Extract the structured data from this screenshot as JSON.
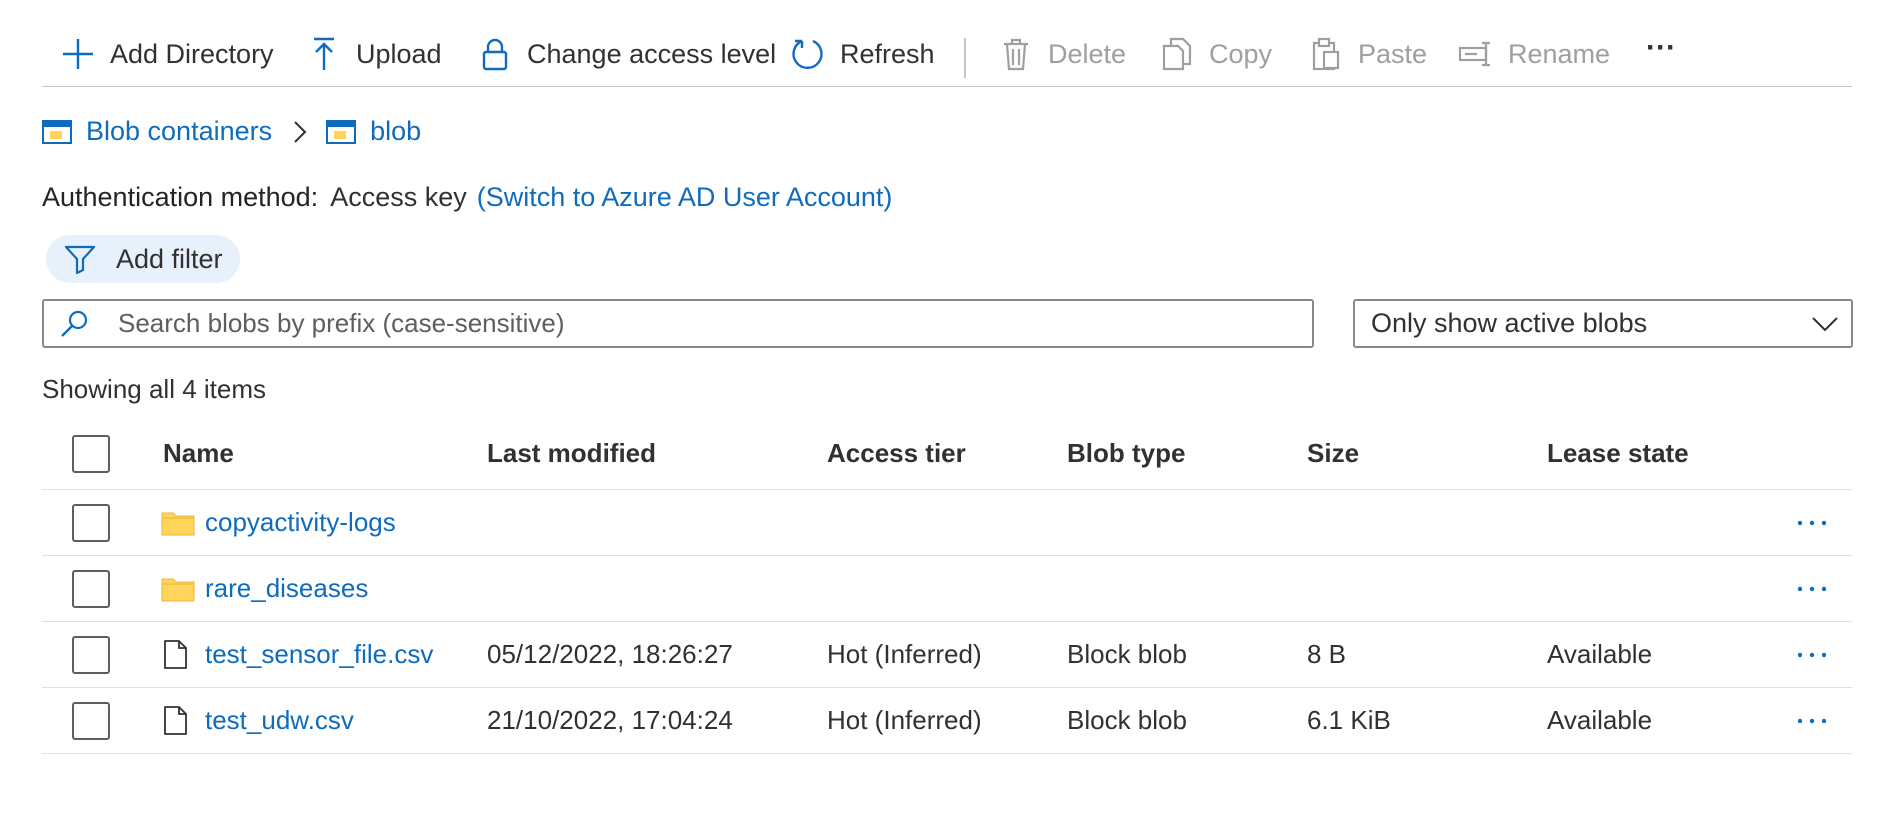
{
  "toolbar": {
    "add_directory": "Add Directory",
    "upload": "Upload",
    "change_access": "Change access level",
    "refresh": "Refresh",
    "delete": "Delete",
    "copy": "Copy",
    "paste": "Paste",
    "rename": "Rename",
    "more": "···"
  },
  "breadcrumb": {
    "containers": "Blob containers",
    "separator": ">",
    "current": "blob"
  },
  "auth": {
    "label": "Authentication method:",
    "value": "Access key",
    "switch_link": "(Switch to Azure AD User Account)"
  },
  "filter": {
    "add_filter": "Add filter"
  },
  "search": {
    "placeholder": "Search blobs by prefix (case-sensitive)"
  },
  "dropdown": {
    "selected": "Only show active blobs"
  },
  "status": {
    "count_text": "Showing all 4 items"
  },
  "table": {
    "headers": {
      "name": "Name",
      "last_modified": "Last modified",
      "access_tier": "Access tier",
      "blob_type": "Blob type",
      "size": "Size",
      "lease_state": "Lease state"
    },
    "rows": [
      {
        "icon": "folder-icon",
        "name": "copyactivity-logs",
        "last_modified": "",
        "access_tier": "",
        "blob_type": "",
        "size": "",
        "lease_state": ""
      },
      {
        "icon": "folder-icon",
        "name": "rare_diseases",
        "last_modified": "",
        "access_tier": "",
        "blob_type": "",
        "size": "",
        "lease_state": ""
      },
      {
        "icon": "file-icon",
        "name": "test_sensor_file.csv",
        "last_modified": "05/12/2022, 18:26:27",
        "access_tier": "Hot (Inferred)",
        "blob_type": "Block blob",
        "size": "8 B",
        "lease_state": "Available"
      },
      {
        "icon": "file-icon",
        "name": "test_udw.csv",
        "last_modified": "21/10/2022, 17:04:24",
        "access_tier": "Hot (Inferred)",
        "blob_type": "Block blob",
        "size": "6.1 KiB",
        "lease_state": "Available"
      }
    ],
    "row_more": "···"
  },
  "colors": {
    "link": "#0f6cbd",
    "folder": "#ffd55c",
    "disabled": "#a19f9d",
    "filter_bg": "#e6f1fb"
  }
}
